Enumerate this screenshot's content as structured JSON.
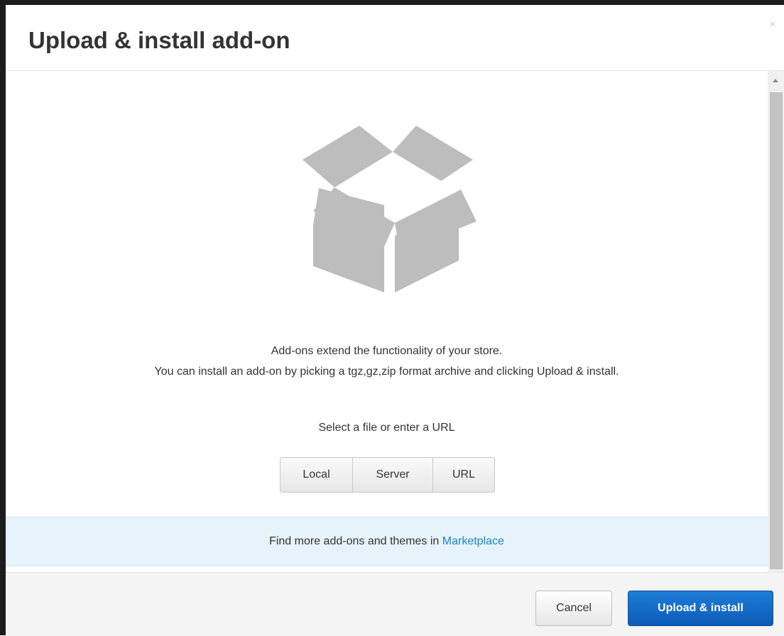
{
  "dialog": {
    "title": "Upload & install add-on",
    "close_glyph": "×"
  },
  "intro": {
    "line1": "Add-ons extend the functionality of your store.",
    "line2": "You can install an add-on by picking a tgz,gz,zip format archive and clicking Upload & install."
  },
  "source": {
    "label": "Select a file or enter a URL",
    "options": [
      "Local",
      "Server",
      "URL"
    ]
  },
  "marketplace": {
    "text": "Find more add-ons and themes in",
    "link": "Marketplace"
  },
  "footer": {
    "cancel_label": "Cancel",
    "submit_label": "Upload & install"
  },
  "icons": {
    "illustration": "open-box-icon",
    "close": "close-icon",
    "scroll_up": "scroll-up-arrow-icon"
  },
  "colors": {
    "primary_button": "#0c5bb7",
    "link": "#1b84c6",
    "info_bar": "#e6f3fb",
    "illustration": "#bdbdbd"
  }
}
